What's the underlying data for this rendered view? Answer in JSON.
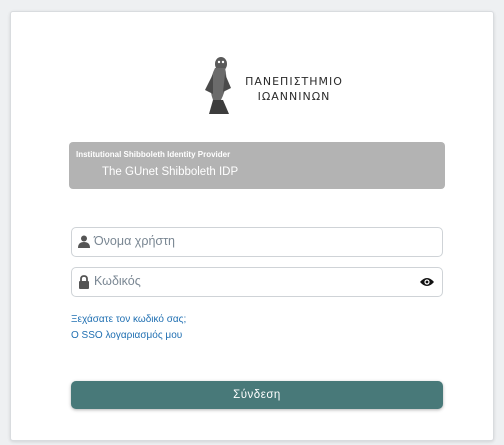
{
  "logo": {
    "line1": "ΠΑΝΕΠΙΣΤΗΜΙΟ",
    "line2": "ΙΩΑΝΝΙΝΩΝ"
  },
  "idp": {
    "title": "Institutional Shibboleth Identity Provider",
    "name": "The GUnet Shibboleth IDP"
  },
  "form": {
    "username_placeholder": "Όνομα χρήστη",
    "password_placeholder": "Κωδικός",
    "forgot_link": "Ξεχάσατε τον κωδικό σας;",
    "sso_link": "Ο SSO λογαριασμός μου",
    "submit_label": "Σύνδεση"
  },
  "icons": {
    "user": "user-icon",
    "lock": "lock-icon",
    "eye": "eye-icon",
    "logo": "owl-logo"
  },
  "colors": {
    "button": "#487979",
    "idp_box": "#b3b3b3",
    "link": "#1f6fb2"
  }
}
